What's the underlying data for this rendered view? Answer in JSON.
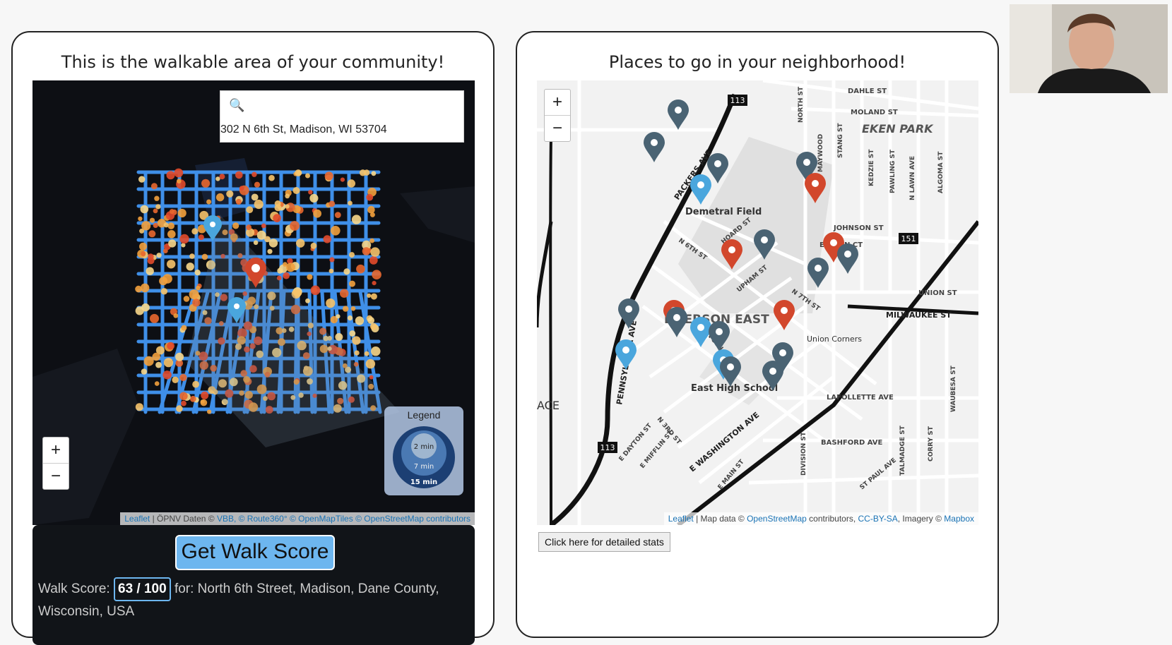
{
  "left_panel": {
    "title": "This is the walkable area of your community!",
    "search": {
      "icon": "search-icon",
      "value": "302 N 6th St, Madison, WI 53704"
    },
    "zoom": {
      "in": "+",
      "out": "−"
    },
    "legend": {
      "title": "Legend",
      "rings": [
        "2 min",
        "7 min",
        "15 min"
      ]
    },
    "attribution": {
      "leaflet": "Leaflet",
      "text": " | ÖPNV Daten © ",
      "links": "VBB, © Route360° © OpenMapTiles © OpenStreetMap contributors"
    },
    "walk_score": {
      "button_label": "Get Walk Score",
      "prefix": "Walk Score:",
      "value": "63 / 100",
      "suffix": "for: North 6th Street, Madison, Dane County, Wisconsin, USA"
    }
  },
  "right_panel": {
    "title": "Places to go in your neighborhood!",
    "zoom": {
      "in": "+",
      "out": "−"
    },
    "map_labels": {
      "neighborhoods": [
        "EKEN PARK",
        "EMERSON EAST"
      ],
      "places": [
        "Demetral Field",
        "East High School",
        "Union Corners"
      ],
      "streets": [
        "DAHLE ST",
        "MOLAND ST",
        "JOHNSON ST",
        "E LAWN CT",
        "UNION ST",
        "MILWAUKEE ST",
        "LAFOLLETTE AVE",
        "BASHFORD AVE",
        "E WASHINGTON AVE",
        "PACKERS AVE",
        "PENNSYLVANIA AVE",
        "HOARD ST",
        "N 6TH ST",
        "N 7TH ST",
        "N 5TH ST",
        "N 3RD ST",
        "E DAYTON ST",
        "E MIFFLIN ST",
        "E MAIN ST",
        "DIVISION ST",
        "ST PAUL AVE",
        "CORRY ST",
        "TALMADGE ST",
        "WAUBESA ST",
        "KEDZIE ST",
        "PAWLING ST",
        "N LAWN AVE",
        "ALGOMA ST",
        "STANG ST",
        "MAYWOOD",
        "NORTH ST",
        "UPHAM ST"
      ],
      "route_shields": [
        "113",
        "151",
        "113"
      ],
      "edge_text": "ACE"
    },
    "attribution": {
      "leaflet": "Leaflet",
      "text1": " | Map data © ",
      "osm": "OpenStreetMap",
      "text2": " contributors, ",
      "license": "CC-BY-SA",
      "text3": ", Imagery © ",
      "mapbox": "Mapbox"
    },
    "stats_button": "Click here for detailed stats"
  },
  "colors": {
    "route_blue": "#3f8fe8",
    "marker_gray": "#4a6373",
    "marker_red": "#d2472c",
    "marker_blue": "#4aa6dd",
    "score_accent": "#6db6ef"
  }
}
